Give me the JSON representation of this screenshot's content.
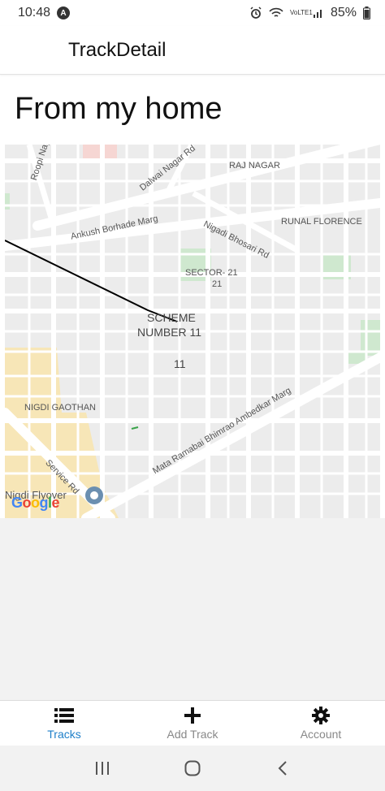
{
  "status_bar": {
    "time": "10:48",
    "notification_icon": "app-notification-icon",
    "network": "VoLTE1",
    "battery": "85%"
  },
  "header": {
    "title": "TrackDetail"
  },
  "track": {
    "name": "From my home"
  },
  "map": {
    "labels": {
      "roopi": "Roopi Nagar Rd",
      "dalwai": "Dalwai Nagar Rd",
      "raj_nagar": "RAJ NAGAR",
      "ankush": "Ankush Borhade Marg",
      "nigadi_bhosari": "Nigadi Bhosari Rd",
      "runal": "RUNAL FLORENCE",
      "sector": "SECTOR- 21",
      "sector_num": "21",
      "scheme": "SCHEME",
      "scheme_num": "NUMBER 11",
      "eleven": "11",
      "nigdi_gaothan": "NIGDI GAOTHAN",
      "mata": "Mata Ramabai Bhimrao Ambedkar Marg",
      "service": "Service Rd",
      "flyover": "Nigdi Flyover"
    },
    "attribution": [
      "G",
      "o",
      "o",
      "g",
      "l",
      "e"
    ]
  },
  "tabs": [
    {
      "label": "Tracks",
      "icon": "list-icon",
      "active": true
    },
    {
      "label": "Add Track",
      "icon": "plus-icon",
      "active": false
    },
    {
      "label": "Account",
      "icon": "gear-icon",
      "active": false
    }
  ],
  "colors": {
    "accent": "#1e7fc9",
    "inactive": "#888888"
  }
}
